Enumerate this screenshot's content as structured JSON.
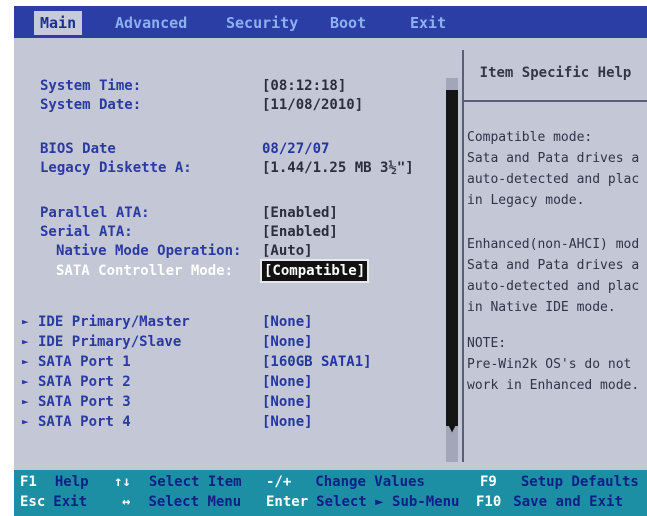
{
  "menu": {
    "tabs": [
      {
        "label": "Main",
        "active": true
      },
      {
        "label": "Advanced",
        "active": false
      },
      {
        "label": "Security",
        "active": false
      },
      {
        "label": "Boot",
        "active": false
      },
      {
        "label": "Exit",
        "active": false
      }
    ]
  },
  "main": {
    "items": [
      {
        "label": "System Time:",
        "value": "[08:12:18]"
      },
      {
        "label": "System Date:",
        "value": "[11/08/2010]"
      },
      {
        "label": "BIOS Date",
        "value": "08/27/07"
      },
      {
        "label": "Legacy Diskette A:",
        "value": "[1.44/1.25 MB  3½\"]"
      },
      {
        "label": "Parallel ATA:",
        "value": "[Enabled]"
      },
      {
        "label": "Serial ATA:",
        "value": "[Enabled]"
      },
      {
        "label": "Native Mode Operation:",
        "value": "[Auto]"
      },
      {
        "label": "SATA Controller Mode:",
        "value": "[Compatible]"
      },
      {
        "label": "IDE Primary/Master",
        "value": "[None]"
      },
      {
        "label": "IDE Primary/Slave",
        "value": "[None]"
      },
      {
        "label": "SATA Port 1",
        "value": "[160GB SATA1]"
      },
      {
        "label": "SATA Port 2",
        "value": "[None]"
      },
      {
        "label": "SATA Port 3",
        "value": "[None]"
      },
      {
        "label": "SATA Port 4",
        "value": "[None]"
      }
    ],
    "submenu_arrow": "►"
  },
  "help": {
    "title": "Item Specific Help",
    "lines": [
      "Compatible mode:",
      "Sata and Pata drives a",
      "auto-detected and plac",
      "in Legacy mode.",
      "Enhanced(non-AHCI) mod",
      "Sata and Pata drives a",
      "auto-detected and plac",
      "in Native IDE mode.",
      "NOTE:",
      "Pre-Win2k OS's do not",
      "work in Enhanced mode."
    ]
  },
  "footer": {
    "keys": [
      {
        "key": "F1",
        "text": "Help"
      },
      {
        "key": "↑↓",
        "text": "Select Item"
      },
      {
        "key": "-/+",
        "text": "Change Values"
      },
      {
        "key": "F9",
        "text": "Setup Defaults"
      },
      {
        "key": "Esc",
        "text": "Exit"
      },
      {
        "key": "↔",
        "text": "Select Menu"
      },
      {
        "key": "Enter",
        "text": "Select ► Sub-Menu"
      },
      {
        "key": "F10",
        "text": "Save and Exit"
      }
    ]
  },
  "scrollbar": {
    "down_glyph": "▼"
  },
  "colors": {
    "screen_bg": "#c4c7d6",
    "menubar_bg": "#2a3ea6",
    "footer_bg": "#1d8fa4",
    "label_blue": "#2a3aa2",
    "highlight_bg": "#111111"
  }
}
